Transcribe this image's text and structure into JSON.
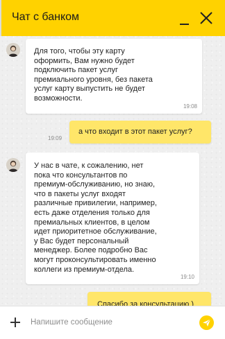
{
  "header": {
    "title": "Чат с банком",
    "minimize_icon": "minimize-icon",
    "close_icon": "close-icon"
  },
  "messages": [
    {
      "sender": "bank",
      "text": "Для того, чтобы эту карту\nоформить, Вам нужно будет\nподключить пакет услуг\nпремиального уровня, без пакета\nуслуг карту выпустить не будет\nвозможности.",
      "time": "19:08"
    },
    {
      "sender": "user",
      "text": "а что входит в этот пакет услуг?",
      "time": "19:09"
    },
    {
      "sender": "bank",
      "text": "У нас в чате, к сожалению, нет\nпока что консультантов по\nпремиум-обслуживанию, но знаю,\nчто в пакеты услуг входят\nразличные привилегии, например,\nесть даже отделения только для\nпремиальных клиентов, в целом\nидет приоритетное обслуживание,\nу Вас будет персональный\nменеджер. Более подробно Вас\nмогут проконсультировать именно\nколлеги из премиум-отдела.",
      "time": "19:10"
    },
    {
      "sender": "user",
      "text": "Спасибо за консультацию )"
    }
  ],
  "input": {
    "placeholder": "Напишите сообщение",
    "value": "",
    "attach_icon": "plus-icon",
    "send_icon": "send-icon"
  },
  "colors": {
    "accent": "#ffd200",
    "user_bubble": "#ffe669",
    "background": "#efefef"
  }
}
